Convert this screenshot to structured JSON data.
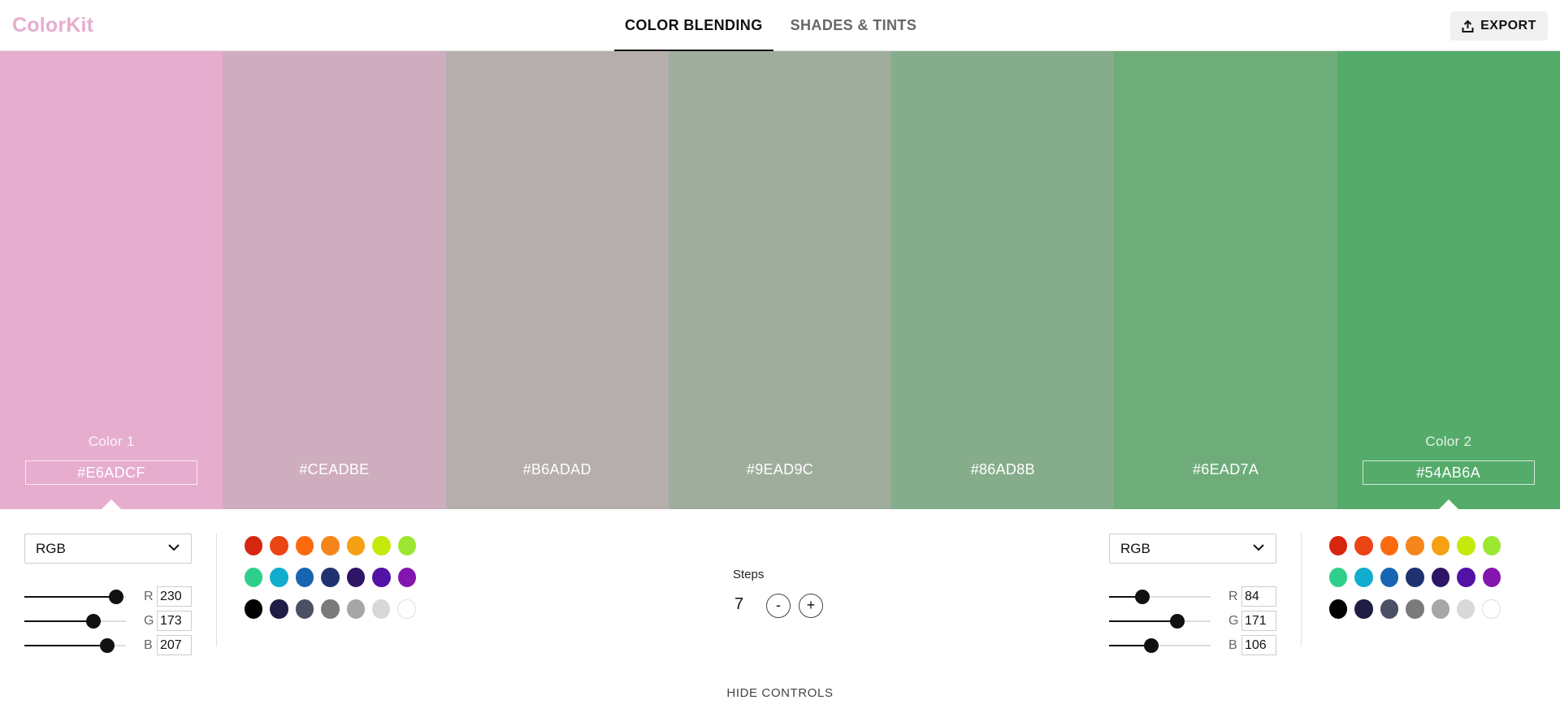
{
  "header": {
    "logo": "ColorKit",
    "tabs": [
      {
        "label": "COLOR BLENDING",
        "active": true
      },
      {
        "label": "SHADES & TINTS",
        "active": false
      }
    ],
    "export_label": "EXPORT",
    "export_icon": "upload-icon"
  },
  "swatches": [
    {
      "hex": "#E6ADCF",
      "color": "#E6ADCF",
      "label": "Color 1"
    },
    {
      "hex": "#CEADBE",
      "color": "#CEADBE"
    },
    {
      "hex": "#B6ADAD",
      "color": "#B6ADAD"
    },
    {
      "hex": "#9EAD9C",
      "color": "#9EAD9C"
    },
    {
      "hex": "#86AD8B",
      "color": "#86AD8B"
    },
    {
      "hex": "#6EAD7A",
      "color": "#6EAD7A"
    },
    {
      "hex": "#54AB6A",
      "color": "#54AB6A",
      "label": "Color 2"
    }
  ],
  "color1": {
    "mode": "RGB",
    "channels": [
      {
        "label": "R",
        "value": "230",
        "level": 0.902
      },
      {
        "label": "G",
        "value": "173",
        "level": 0.678
      },
      {
        "label": "B",
        "value": "207",
        "level": 0.812
      }
    ]
  },
  "color2": {
    "mode": "RGB",
    "channels": [
      {
        "label": "R",
        "value": "84",
        "level": 0.329
      },
      {
        "label": "G",
        "value": "171",
        "level": 0.671
      },
      {
        "label": "B",
        "value": "106",
        "level": 0.416
      }
    ]
  },
  "palette": [
    [
      "#D7260F",
      "#EB4415",
      "#FC6A0F",
      "#F6851C",
      "#F6A014",
      "#C6E90C",
      "#9CE731"
    ],
    [
      "#2ECF8B",
      "#11ADCE",
      "#1765B2",
      "#203270",
      "#2F1565",
      "#5212A6",
      "#8316AF"
    ],
    [
      "#000000",
      "#1D1D45",
      "#4D4F65",
      "#7A7A7A",
      "#A6A6A6",
      "#D8D8D8",
      "#FFFFFF"
    ]
  ],
  "steps": {
    "label": "Steps",
    "value": "7",
    "minus": "-",
    "plus": "+"
  },
  "hide_controls": "HIDE CONTROLS",
  "colors": {
    "accent": "#E6ADCF"
  }
}
